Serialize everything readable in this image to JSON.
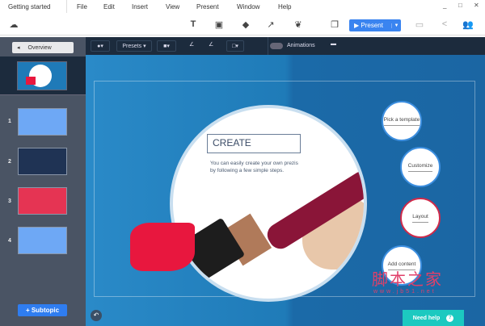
{
  "menu": {
    "title": "Getting started",
    "items": [
      "File",
      "Edit",
      "Insert",
      "View",
      "Present",
      "Window",
      "Help"
    ]
  },
  "window_controls": {
    "minimize": "_",
    "maximize": "□",
    "close": "✕"
  },
  "toolbar": {
    "present_label": "Present"
  },
  "darkbar": {
    "presets": "Presets ▾",
    "animations": "Animations"
  },
  "sidebar": {
    "overview": "Overview",
    "slides": [
      "1",
      "2",
      "3",
      "4"
    ],
    "subtopic": "+ Subtopic"
  },
  "slide": {
    "title": "CREATE",
    "description": "You can easily create your own prezis by following a few simple steps.",
    "bubbles": [
      "Pick a template",
      "Customize",
      "Layout",
      "Add content"
    ]
  },
  "help": {
    "label": "Need help"
  },
  "watermark": {
    "text": "脚本之家",
    "url": "www.jb51.net"
  },
  "colors": {
    "accent": "#3a84f0",
    "help": "#1cc9c0",
    "selected": "#d02a4a"
  }
}
